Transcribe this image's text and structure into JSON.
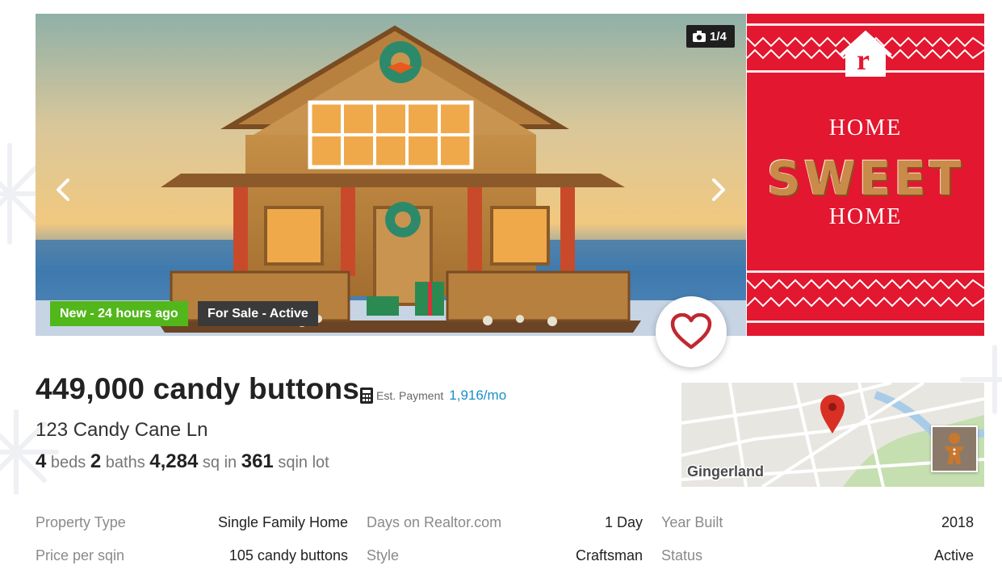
{
  "gallery": {
    "photo_counter": "1/4",
    "badge_new": "New - 24 hours ago",
    "badge_status": "For Sale - Active"
  },
  "ad": {
    "logo_letter": "r",
    "line1": "HOME",
    "line2": "SWEET",
    "line3": "HOME"
  },
  "listing": {
    "price": "449,000 candy buttons",
    "est_payment_label": "Est. Payment",
    "est_payment_value": "1,916/mo",
    "address": "123 Candy Cane Ln",
    "beds": "4",
    "beds_label": "beds",
    "baths": "2",
    "baths_label": "baths",
    "sqft": "4,284",
    "sqft_label": "sq in",
    "lot": "361",
    "lot_label": "sqin lot"
  },
  "map": {
    "label": "Gingerland"
  },
  "facts": {
    "property_type_label": "Property Type",
    "property_type_value": "Single Family Home",
    "days_label": "Days on Realtor.com",
    "days_value": "1 Day",
    "year_built_label": "Year Built",
    "year_built_value": "2018",
    "price_per_label": "Price per sqin",
    "price_per_value": "105 candy buttons",
    "style_label": "Style",
    "style_value": "Craftsman",
    "status_label": "Status",
    "status_value": "Active"
  },
  "colors": {
    "new_badge": "#52b71a",
    "ad_red": "#e3172f",
    "payment_link": "#1b8fc6",
    "heart": "#c0282f"
  }
}
